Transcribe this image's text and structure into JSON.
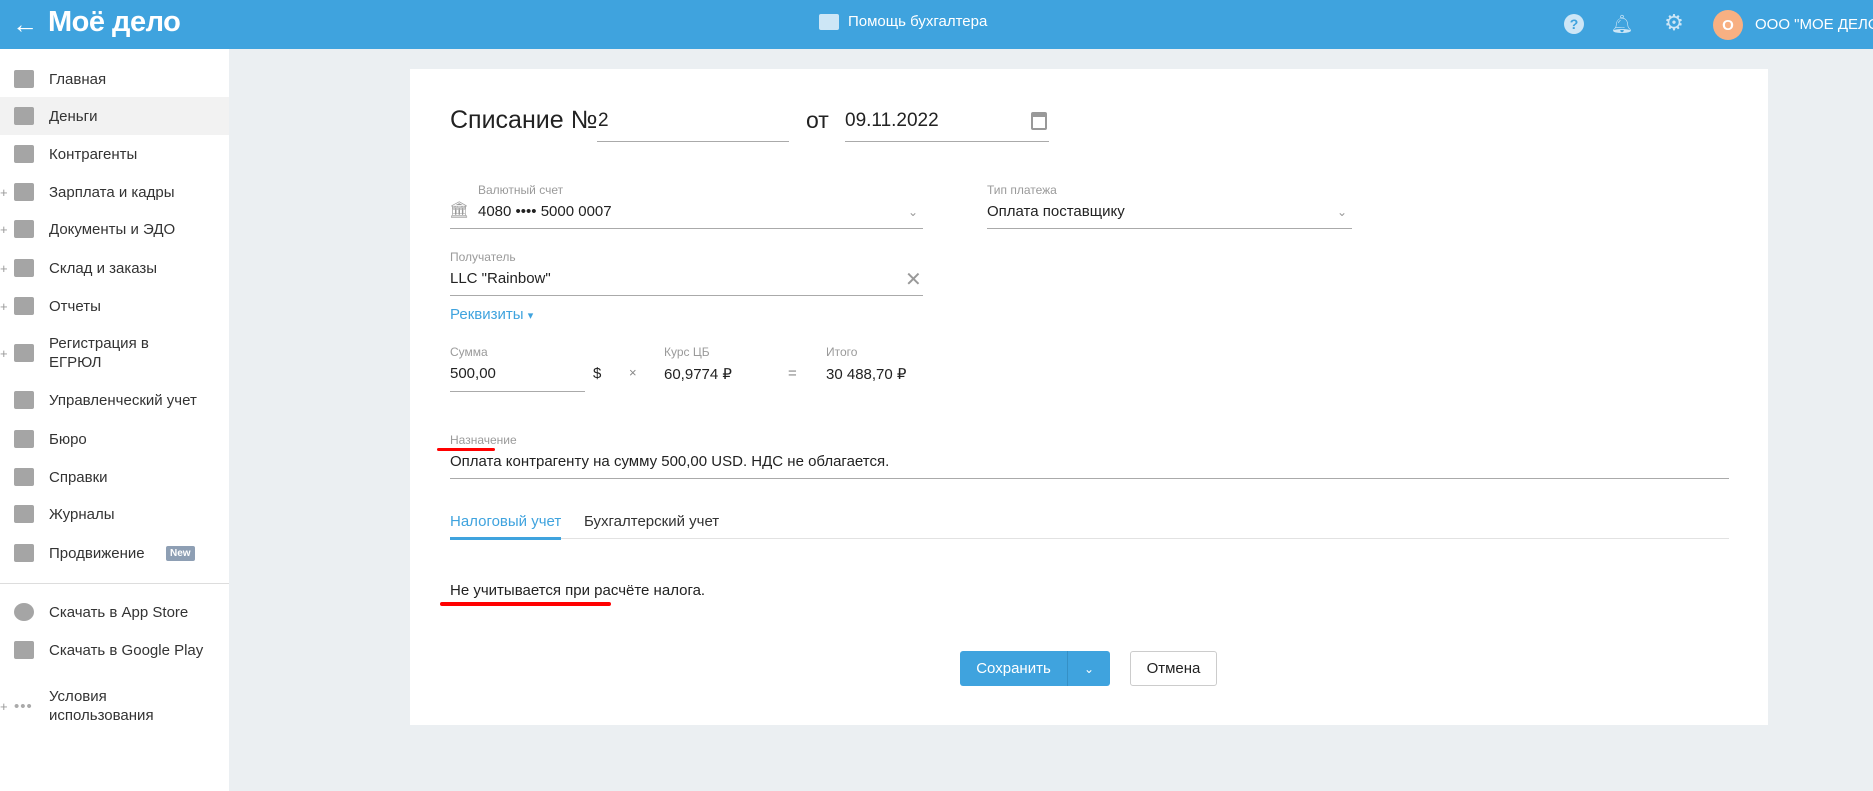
{
  "header": {
    "back_icon": "arrow-left-icon",
    "logo": "Моё дело",
    "help_link": "Помощь бухгалтера",
    "org_initial": "О",
    "org_name": "ООО \"МОЕ ДЕЛО\""
  },
  "sidebar": {
    "items": [
      {
        "label": "Главная",
        "icon": "home-icon",
        "expandable": false
      },
      {
        "label": "Деньги",
        "icon": "money-icon",
        "expandable": false,
        "active": true
      },
      {
        "label": "Контрагенты",
        "icon": "contractors-icon",
        "expandable": false
      },
      {
        "label": "Зарплата и кадры",
        "icon": "salary-icon",
        "expandable": true
      },
      {
        "label": "Документы и ЭДО",
        "icon": "documents-icon",
        "expandable": true
      },
      {
        "label": "Склад и заказы",
        "icon": "warehouse-icon",
        "expandable": true
      },
      {
        "label": "Отчеты",
        "icon": "reports-icon",
        "expandable": true
      },
      {
        "label": "Регистрация в ЕГРЮЛ",
        "icon": "registration-icon",
        "expandable": true
      },
      {
        "label": "Управленческий учет",
        "icon": "management-icon",
        "expandable": false
      },
      {
        "label": "Бюро",
        "icon": "briefcase-icon",
        "expandable": false
      },
      {
        "label": "Справки",
        "icon": "references-icon",
        "expandable": false
      },
      {
        "label": "Журналы",
        "icon": "journals-icon",
        "expandable": false
      },
      {
        "label": "Продвижение",
        "icon": "promotion-icon",
        "expandable": false,
        "badge": "New"
      }
    ],
    "bottom_items": [
      {
        "label": "Скачать в App Store",
        "icon": "apple-icon"
      },
      {
        "label": "Скачать в Google Play",
        "icon": "google-play-icon"
      },
      {
        "label": "Условия использования",
        "icon": "more-icon"
      }
    ]
  },
  "form": {
    "title": "Списание №",
    "number": "2",
    "date_prefix": "от",
    "date": "09.11.2022",
    "account": {
      "label": "Валютный счет",
      "value": "4080 •••• 5000 0007"
    },
    "payment_type": {
      "label": "Тип платежа",
      "value": "Оплата поставщику"
    },
    "recipient": {
      "label": "Получатель",
      "value": "LLC \"Rainbow\""
    },
    "details_link": "Реквизиты",
    "amount": {
      "label": "Сумма",
      "value": "500,00",
      "currency": "$"
    },
    "multiply": "×",
    "rate": {
      "label": "Курс ЦБ",
      "value": "60,9774 ₽"
    },
    "equals": "=",
    "total": {
      "label": "Итого",
      "value": "30 488,70 ₽"
    },
    "purpose": {
      "label": "Назначение",
      "value": "Оплата контрагенту на сумму 500,00 USD. НДС не облагается."
    },
    "tabs": [
      {
        "label": "Налоговый учет",
        "active": true
      },
      {
        "label": "Бухгалтерский учет",
        "active": false
      }
    ],
    "tax_note": "Не учитывается при расчёте налога.",
    "save_label": "Сохранить",
    "cancel_label": "Отмена"
  },
  "colors": {
    "accent": "#3fa3de",
    "annotation": "#ff0000",
    "avatar": "#f8b082"
  }
}
